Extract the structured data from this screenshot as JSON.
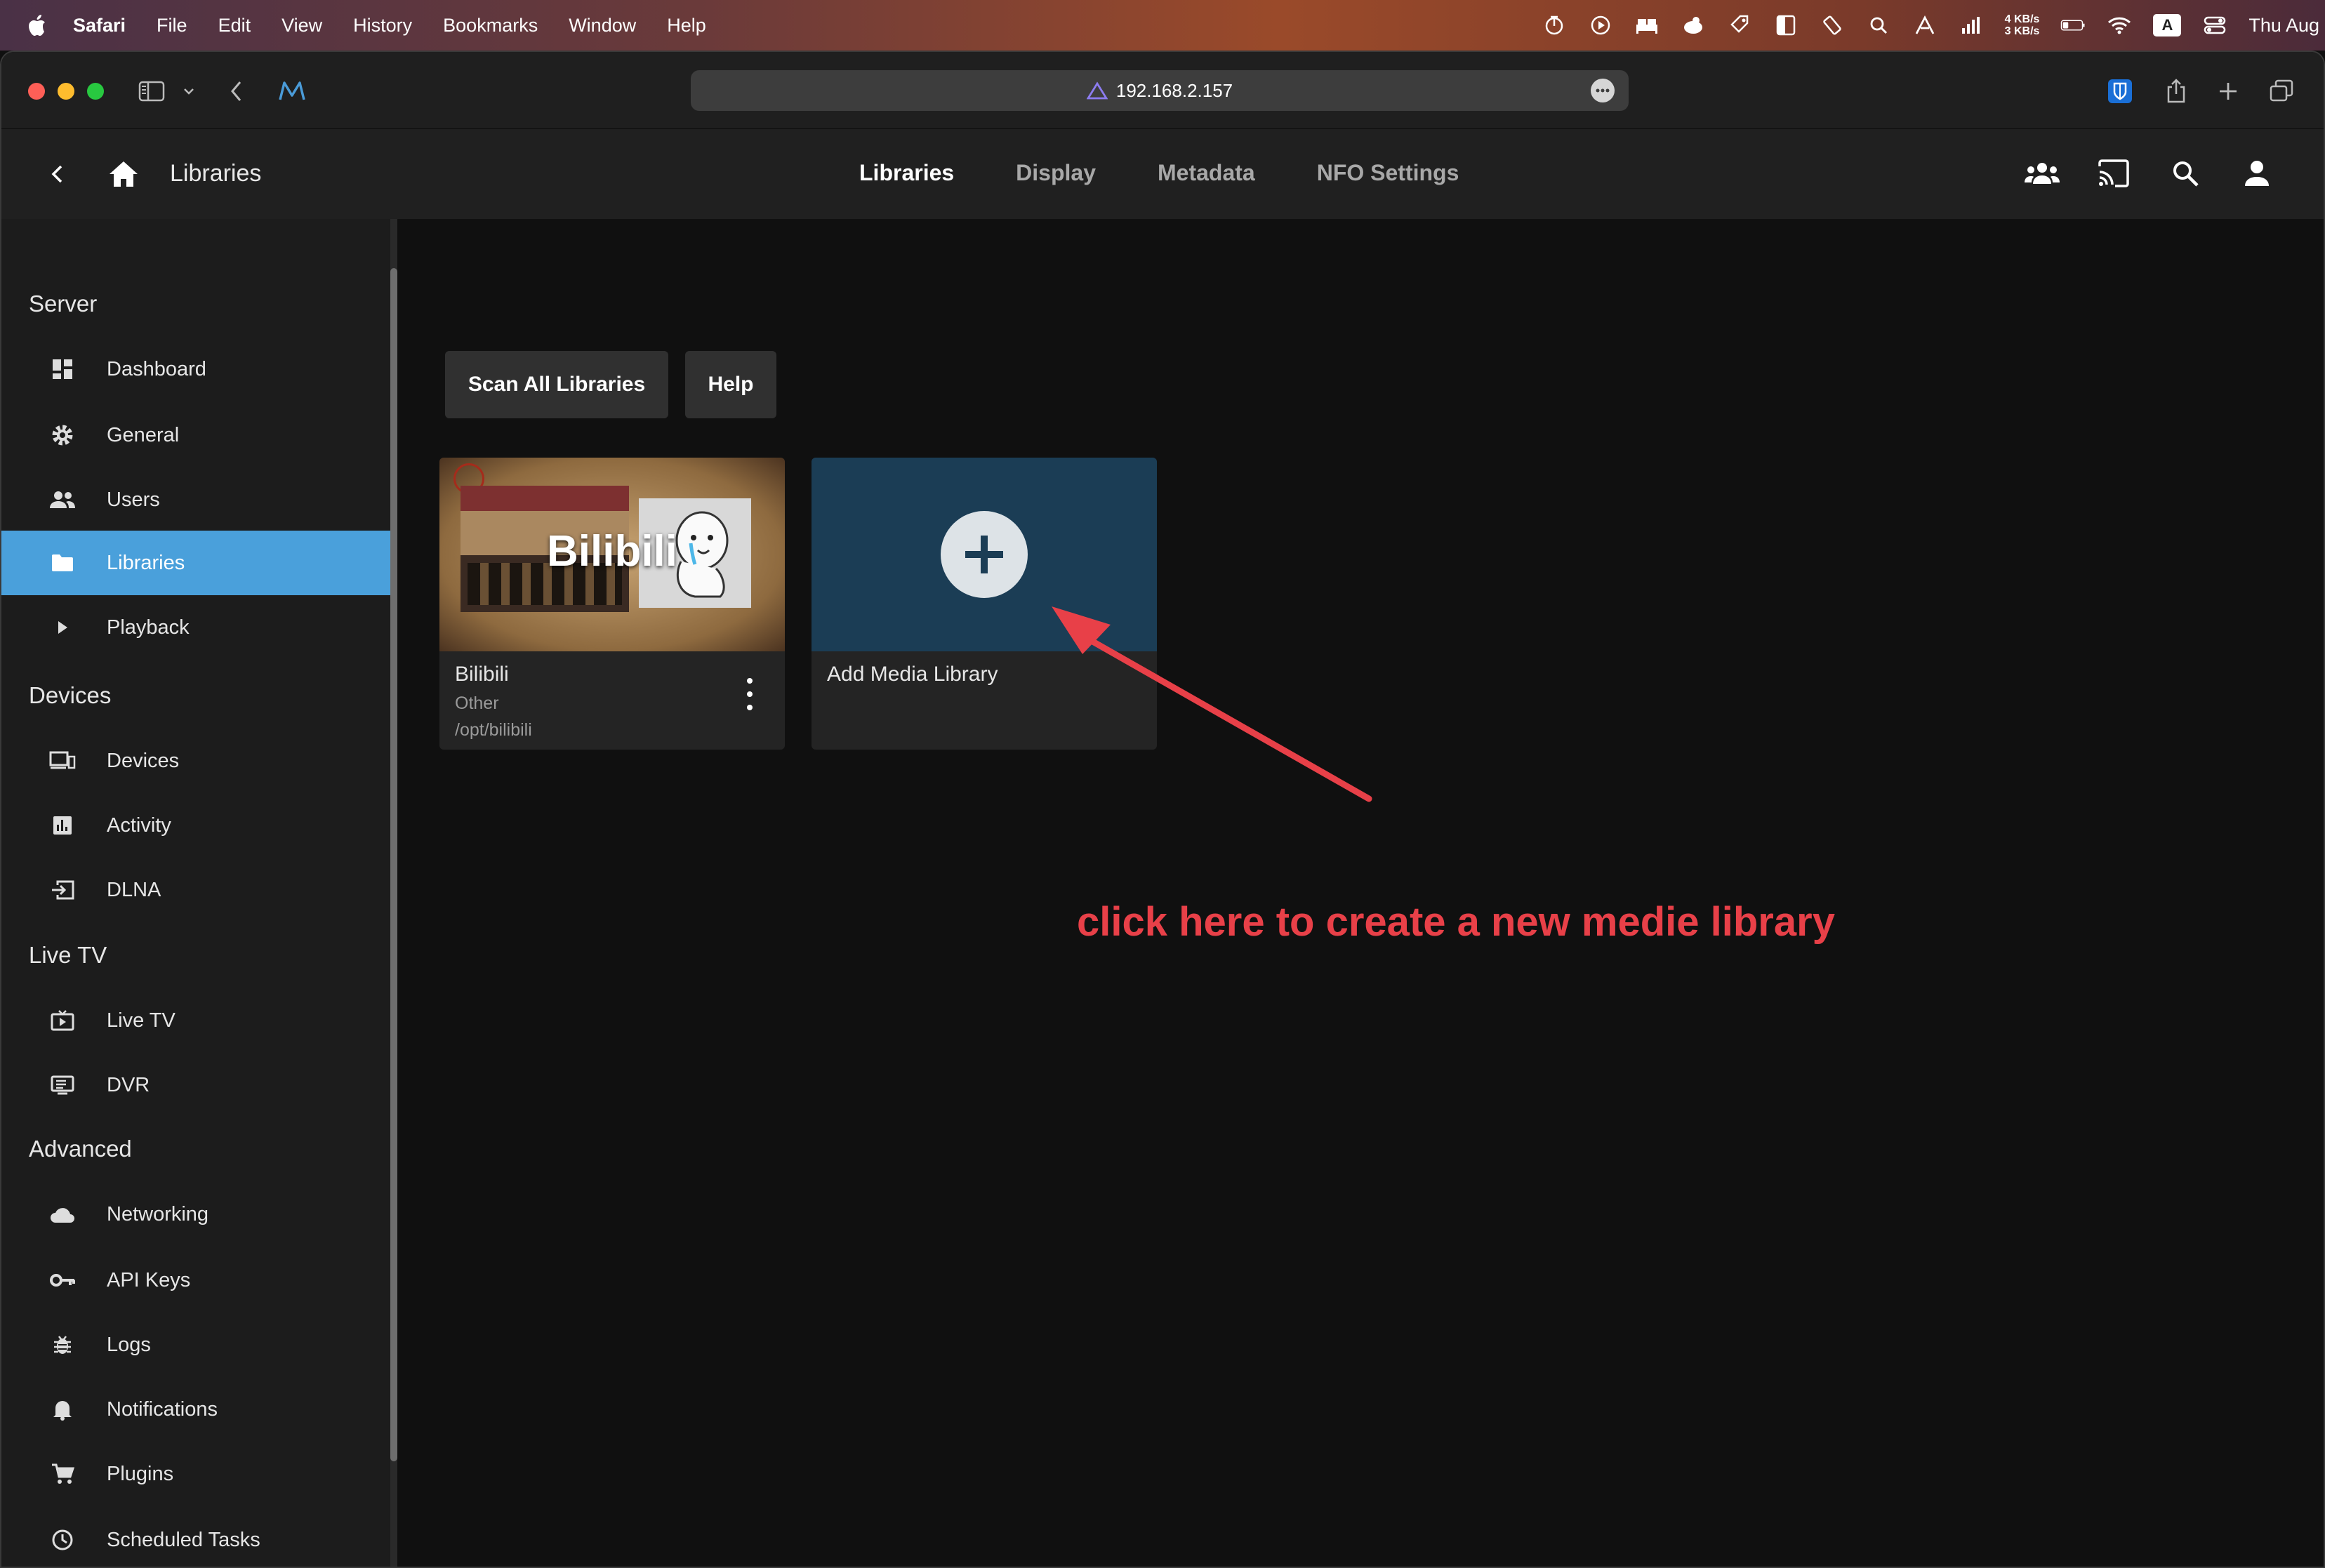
{
  "menubar": {
    "app": "Safari",
    "items": [
      "File",
      "Edit",
      "View",
      "History",
      "Bookmarks",
      "Window",
      "Help"
    ],
    "net_up": "4 KB/s",
    "net_down": "3 KB/s",
    "input_badge": "A",
    "clock": "Thu Aug"
  },
  "browser": {
    "url": "192.168.2.157"
  },
  "header": {
    "title": "Libraries",
    "tabs": [
      "Libraries",
      "Display",
      "Metadata",
      "NFO Settings"
    ]
  },
  "sidebar": {
    "sections": [
      {
        "title": "Server",
        "items": [
          "Dashboard",
          "General",
          "Users",
          "Libraries",
          "Playback"
        ]
      },
      {
        "title": "Devices",
        "items": [
          "Devices",
          "Activity",
          "DLNA"
        ]
      },
      {
        "title": "Live TV",
        "items": [
          "Live TV",
          "DVR"
        ]
      },
      {
        "title": "Advanced",
        "items": [
          "Networking",
          "API Keys",
          "Logs",
          "Notifications",
          "Plugins",
          "Scheduled Tasks"
        ]
      }
    ],
    "active": "Libraries"
  },
  "main": {
    "scan_button": "Scan All Libraries",
    "help_button": "Help",
    "library": {
      "name": "Bilibili",
      "thumb_title": "Bilibili",
      "type": "Other",
      "path": "/opt/bilibili"
    },
    "add_library": "Add Media Library"
  },
  "annotation": "click here to create a new medie library",
  "colors": {
    "accent": "#4aa0db",
    "annotation": "#e84048",
    "add_card": "#1b3d55"
  }
}
